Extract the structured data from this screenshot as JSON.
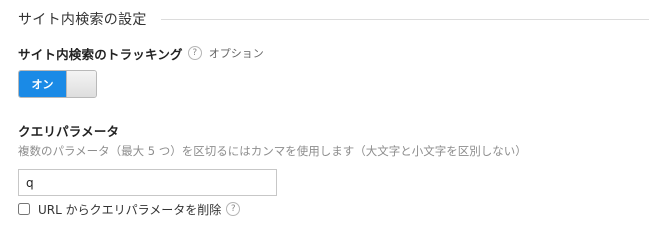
{
  "section": {
    "title": "サイト内検索の設定"
  },
  "tracking": {
    "label": "サイト内検索のトラッキング",
    "help_icon": "question-mark-icon",
    "help_symbol": "?",
    "option_text": "オプション",
    "toggle": {
      "state": "on",
      "on_label": "オン",
      "on_color": "#1a8ae6"
    }
  },
  "query_parameter": {
    "label": "クエリパラメータ",
    "description": "複数のパラメータ（最大 5 つ）を区切るにはカンマを使用します（大文字と小文字を区別しない）",
    "input_value": "q"
  },
  "remove_param": {
    "checked": false,
    "label": "URL からクエリパラメータを削除",
    "help_icon": "question-mark-icon",
    "help_symbol": "?"
  }
}
